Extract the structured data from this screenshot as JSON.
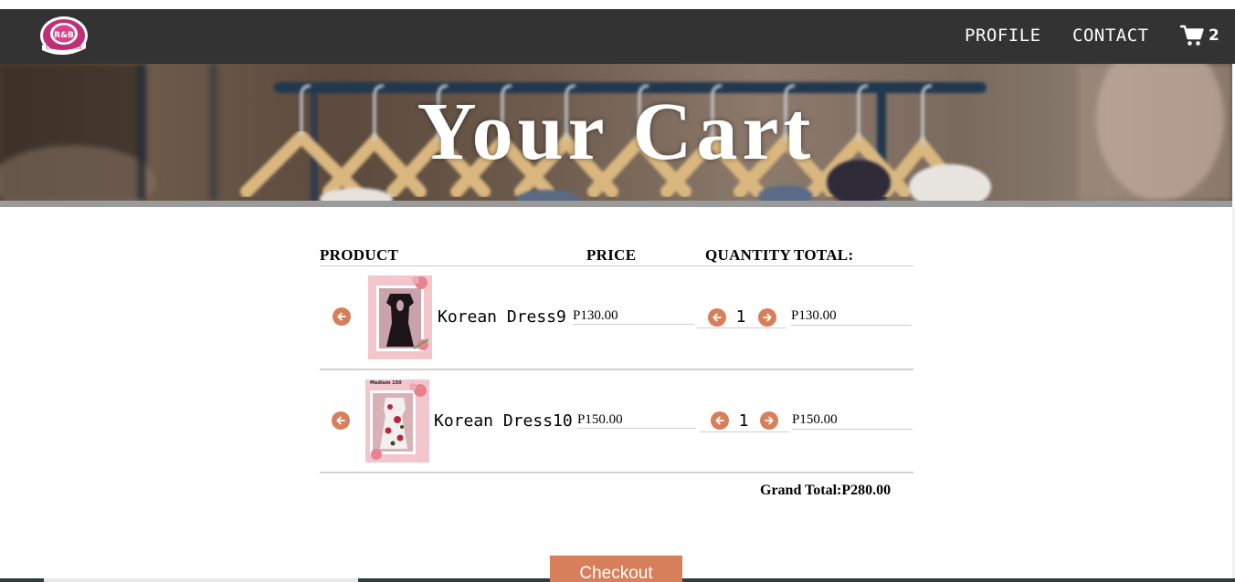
{
  "logo": {
    "text": "R&B Collections"
  },
  "nav": {
    "profile": "PROFILE",
    "contact": "CONTACT",
    "cart_count": "2"
  },
  "hero": {
    "title": "Your Cart"
  },
  "table": {
    "headers": {
      "product": "PRODUCT",
      "price": "PRICE",
      "quantity": "QUANTITY",
      "total": "TOTAL:"
    },
    "rows": [
      {
        "name": "Korean Dress9",
        "price": "P130.00",
        "quantity": "1",
        "total": "P130.00"
      },
      {
        "name": "Korean Dress10",
        "price": "P150.00",
        "quantity": "1",
        "total": "P150.00",
        "thumb_label": "Medium 150"
      }
    ]
  },
  "grand_total": "Grand Total:P280.00",
  "checkout_label": "Checkout",
  "colors": {
    "navbar": "#333333",
    "accent": "#d67f5a",
    "hero_bar": "#9a9a9a"
  },
  "icons": {
    "cart": "shopping-cart-icon",
    "remove": "arrow-left-circle-icon",
    "decrease": "arrow-left-circle-icon",
    "increase": "arrow-right-circle-icon"
  }
}
